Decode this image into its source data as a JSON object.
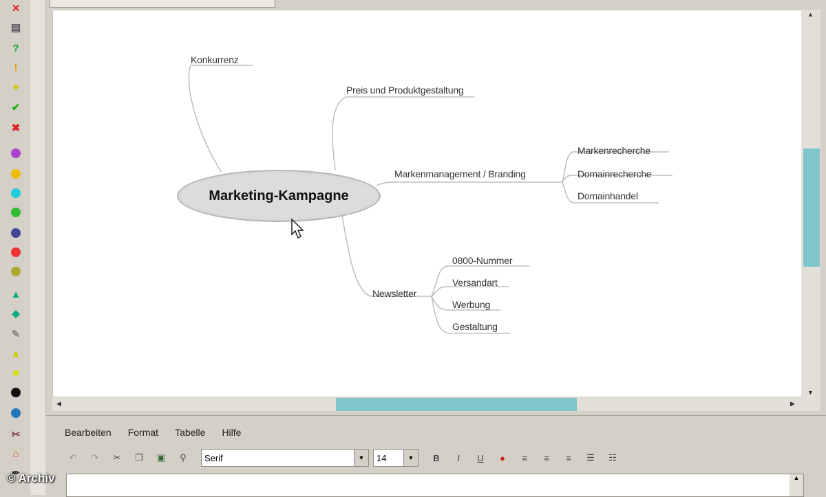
{
  "tab_title": "",
  "mindmap": {
    "central": "Marketing-Kampagne",
    "nodes": {
      "n1": "Konkurrenz",
      "n2": "Preis und Produktgestaltung",
      "n3": "Markenmanagement / Branding",
      "n3a": "Markenrecherche",
      "n3b": "Domainrecherche",
      "n3c": "Domainhandel",
      "n4": "Newsletter",
      "n4a": "0800-Nummer",
      "n4b": "Versandart",
      "n4c": "Werbung",
      "n4d": "Gestaltung"
    }
  },
  "menu": [
    "Bearbeiten",
    "Format",
    "Tabelle",
    "Hilfe"
  ],
  "font_select": {
    "value": "Serif"
  },
  "size_select": {
    "value": "14"
  },
  "watermark": "© Archiv",
  "colors": {
    "scroll_thumb": "#7fc6cc",
    "canvas": "#ffffff",
    "chrome": "#d4d0c8"
  },
  "icons": [
    "close-icon",
    "notes-icon",
    "question-icon",
    "exclamation-icon",
    "lightbulb-icon",
    "checkmark-icon",
    "cross-icon",
    "number-1-icon",
    "yellow-circle-icon",
    "cyan-circle-icon",
    "green-circle-icon",
    "blue-circle-icon",
    "red-circle-icon",
    "olive-circle-icon",
    "arrow-up-icon",
    "arrow-down-icon",
    "pencil-icon",
    "arrow-up-yellow-icon",
    "star-icon",
    "black-circle-icon",
    "blue-globe-icon",
    "wrench-icon",
    "home-icon",
    "pen-icon"
  ]
}
